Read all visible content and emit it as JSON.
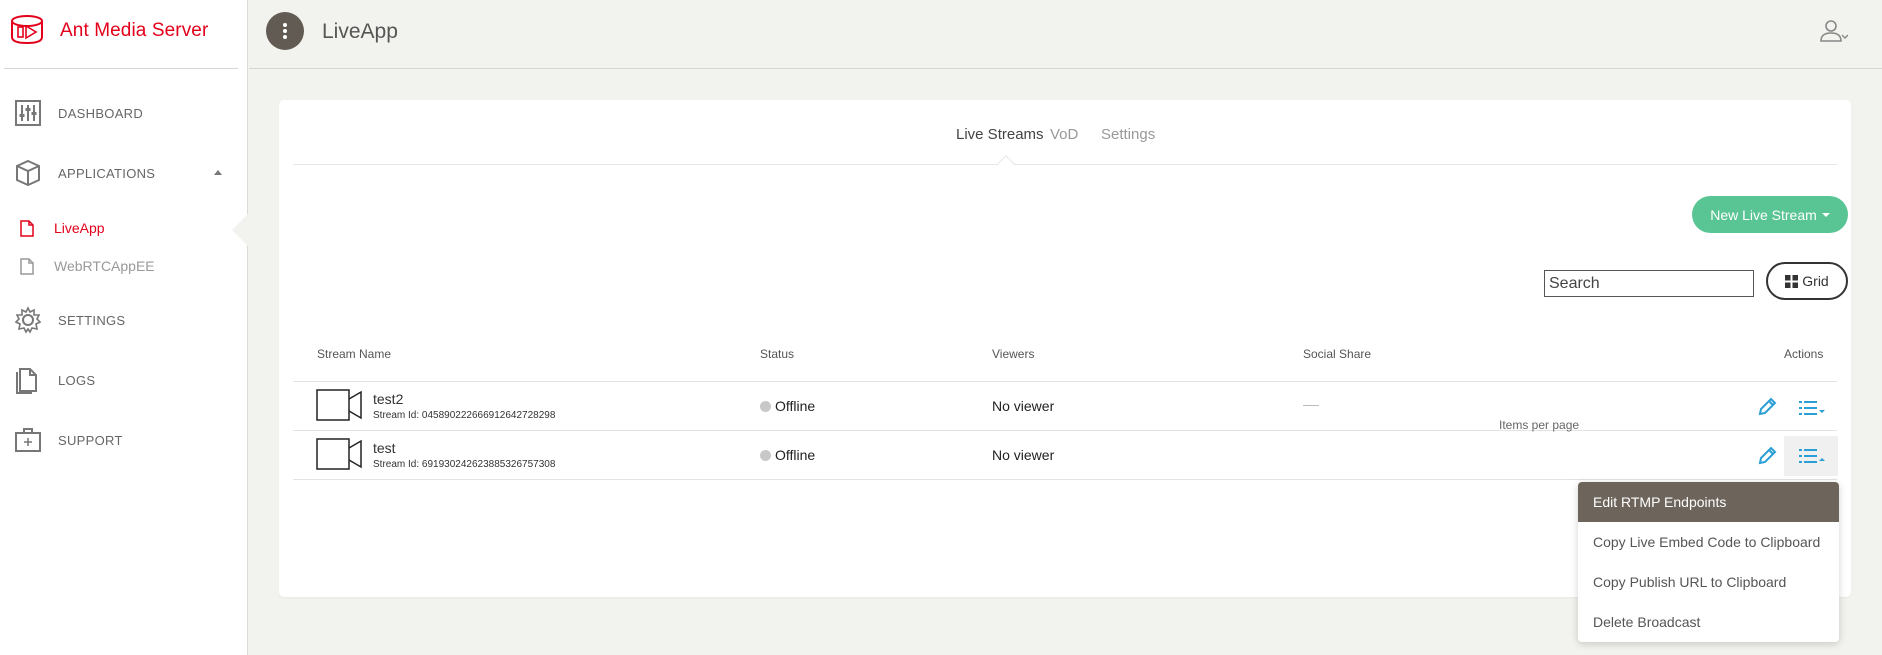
{
  "brand": {
    "name": "Ant Media Server",
    "accent": "#e3001b"
  },
  "sidebar": {
    "items": [
      {
        "label": "DASHBOARD",
        "icon": "sliders-icon"
      },
      {
        "label": "APPLICATIONS",
        "icon": "cube-icon"
      },
      {
        "label": "SETTINGS",
        "icon": "gear-icon"
      },
      {
        "label": "LOGS",
        "icon": "files-icon"
      },
      {
        "label": "SUPPORT",
        "icon": "medkit-icon"
      }
    ],
    "apps": [
      {
        "label": "LiveApp",
        "active": true
      },
      {
        "label": "WebRTCAppEE",
        "active": false
      }
    ]
  },
  "header": {
    "title": "LiveApp"
  },
  "tabs": [
    {
      "label": "Live Streams",
      "active": true
    },
    {
      "label": "VoD",
      "active": false
    },
    {
      "label": "Settings",
      "active": false
    }
  ],
  "toolbar": {
    "new_stream_label": "New Live Stream",
    "search_placeholder": "Search",
    "grid_label": "Grid"
  },
  "table": {
    "columns": [
      "Stream Name",
      "Status",
      "Viewers",
      "Social Share",
      "Actions"
    ],
    "rows": [
      {
        "name": "test2",
        "stream_id": "Stream Id: 045890222666912642728298",
        "status": "Offline",
        "viewers": "No viewer"
      },
      {
        "name": "test",
        "stream_id": "Stream Id: 691930242623885326757308",
        "status": "Offline",
        "viewers": "No viewer"
      }
    ],
    "items_per_page_label": "Items per page"
  },
  "actions_menu": {
    "items": [
      {
        "label": "Edit RTMP Endpoints",
        "active": true
      },
      {
        "label": "Copy Live Embed Code to Clipboard",
        "active": false
      },
      {
        "label": "Copy Publish URL to Clipboard",
        "active": false
      },
      {
        "label": "Delete Broadcast",
        "active": false
      }
    ]
  },
  "colors": {
    "accent_green": "#5ac594",
    "icon_blue": "#2a9fd6",
    "menu_active": "#6d645c"
  }
}
